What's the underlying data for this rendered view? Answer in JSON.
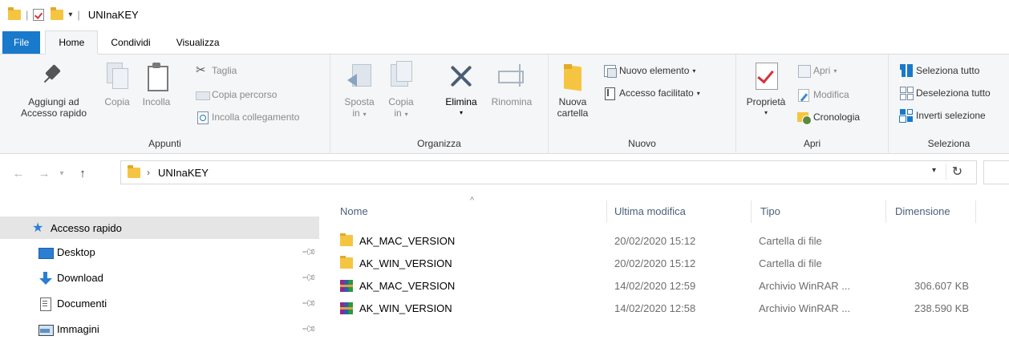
{
  "window": {
    "title": "UNInaKEY"
  },
  "quick_access_toolbar": {
    "icons": [
      "folder-icon",
      "properties-check-icon",
      "new-folder-icon",
      "customize-arrow-icon"
    ]
  },
  "tabs": [
    {
      "label": "File"
    },
    {
      "label": "Home"
    },
    {
      "label": "Condividi"
    },
    {
      "label": "Visualizza"
    }
  ],
  "ribbon": {
    "appunti": {
      "label": "Appunti",
      "pin_line1": "Aggiungi ad",
      "pin_line2": "Accesso rapido",
      "copy": "Copia",
      "paste": "Incolla",
      "cut": "Taglia",
      "copy_path": "Copia percorso",
      "paste_link": "Incolla collegamento"
    },
    "organizza": {
      "label": "Organizza",
      "move_line1": "Sposta",
      "move_line2": "in",
      "copy_line1": "Copia",
      "copy_line2": "in",
      "delete": "Elimina",
      "rename": "Rinomina"
    },
    "nuovo": {
      "label": "Nuovo",
      "new_folder_line1": "Nuova",
      "new_folder_line2": "cartella",
      "new_item": "Nuovo elemento",
      "easy_access": "Accesso facilitato"
    },
    "apri": {
      "label": "Apri",
      "properties": "Proprietà",
      "open": "Apri",
      "edit": "Modifica",
      "history": "Cronologia"
    },
    "seleziona": {
      "label": "Seleziona",
      "select_all": "Seleziona tutto",
      "select_none": "Deseleziona tutto",
      "invert": "Inverti selezione"
    }
  },
  "address": {
    "path": "UNInaKEY"
  },
  "nav_pane": {
    "items": [
      {
        "label": "Accesso rapido",
        "icon": "star-icon",
        "selected": true
      },
      {
        "label": "Desktop",
        "icon": "desktop-icon",
        "pinned": true
      },
      {
        "label": "Download",
        "icon": "download-icon",
        "pinned": true
      },
      {
        "label": "Documenti",
        "icon": "documents-icon",
        "pinned": true
      },
      {
        "label": "Immagini",
        "icon": "images-icon",
        "pinned": true
      }
    ]
  },
  "file_list": {
    "columns": [
      "Nome",
      "Ultima modifica",
      "Tipo",
      "Dimensione"
    ],
    "rows": [
      {
        "name": "AK_MAC_VERSION",
        "modified": "20/02/2020 15:12",
        "type": "Cartella di file",
        "size": "",
        "icon": "folder-icon"
      },
      {
        "name": "AK_WIN_VERSION",
        "modified": "20/02/2020 15:12",
        "type": "Cartella di file",
        "size": "",
        "icon": "folder-icon"
      },
      {
        "name": "AK_MAC_VERSION",
        "modified": "14/02/2020 12:59",
        "type": "Archivio WinRAR ...",
        "size": "306.607 KB",
        "icon": "winrar-icon"
      },
      {
        "name": "AK_WIN_VERSION",
        "modified": "14/02/2020 12:58",
        "type": "Archivio WinRAR ...",
        "size": "238.590 KB",
        "icon": "winrar-icon"
      }
    ]
  },
  "colors": {
    "accent": "#1979ca",
    "folder": "#f5c542",
    "ribbon_bg": "#f5f6f7",
    "header_text": "#4c607a"
  }
}
